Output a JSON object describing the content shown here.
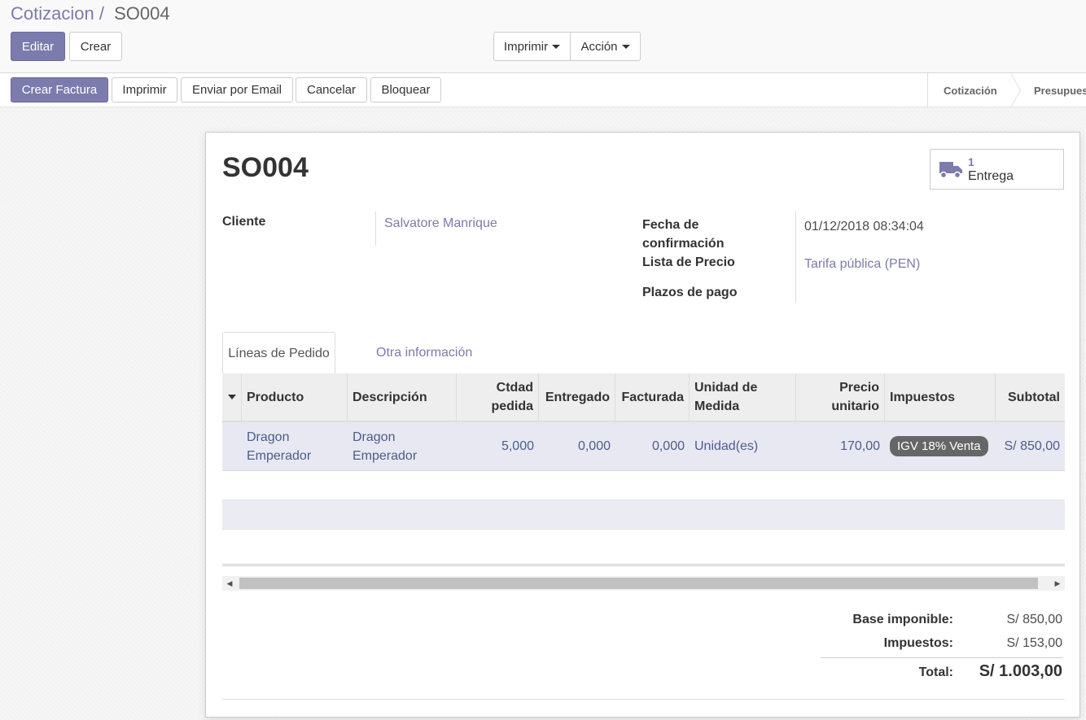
{
  "breadcrumb": {
    "parent": "Cotizacion",
    "separator": "/",
    "current": "SO004"
  },
  "toolbar": {
    "edit": "Editar",
    "create": "Crear",
    "print": "Imprimir",
    "action": "Acción"
  },
  "statusbar": {
    "buttons": [
      "Crear Factura",
      "Imprimir",
      "Enviar por Email",
      "Cancelar",
      "Bloquear"
    ],
    "stages": [
      "Cotización",
      "Presupues"
    ]
  },
  "form": {
    "name": "SO004",
    "smart_button": {
      "count": "1",
      "label": "Entrega",
      "icon": "truck-icon"
    },
    "fields": {
      "customer_label": "Cliente",
      "customer_value": "Salvatore Manrique",
      "confirm_label_1": "Fecha de",
      "confirm_label_2": "confirmación",
      "confirm_value": "01/12/2018 08:34:04",
      "pricelist_label": "Lista de Precio",
      "pricelist_value": "Tarifa pública (PEN)",
      "payment_terms_label": "Plazos de pago"
    },
    "tabs": [
      "Líneas de Pedido",
      "Otra información"
    ],
    "columns": {
      "product": "Producto",
      "description": "Descripción",
      "qty_1": "Ctdad",
      "qty_2": "pedida",
      "delivered": "Entregado",
      "invoiced": "Facturada",
      "uom_1": "Unidad de",
      "uom_2": "Medida",
      "price_1": "Precio",
      "price_2": "unitario",
      "taxes": "Impuestos",
      "subtotal": "Subtotal"
    },
    "lines": [
      {
        "product_1": "Dragon",
        "product_2": "Emperador",
        "description_1": "Dragon",
        "description_2": "Emperador",
        "qty": "5,000",
        "delivered": "0,000",
        "invoiced": "0,000",
        "uom": "Unidad(es)",
        "price": "170,00",
        "tax": "IGV 18% Venta",
        "subtotal": "S/ 850,00"
      }
    ],
    "totals": {
      "untaxed_label": "Base imponible:",
      "untaxed_value": "S/ 850,00",
      "taxes_label": "Impuestos:",
      "taxes_value": "S/ 153,00",
      "total_label": "Total:",
      "total_value": "S/ 1.003,00"
    }
  },
  "colors": {
    "primary": "#7c7bad",
    "row_highlight": "#e8e8f2",
    "tag": "#666666"
  }
}
